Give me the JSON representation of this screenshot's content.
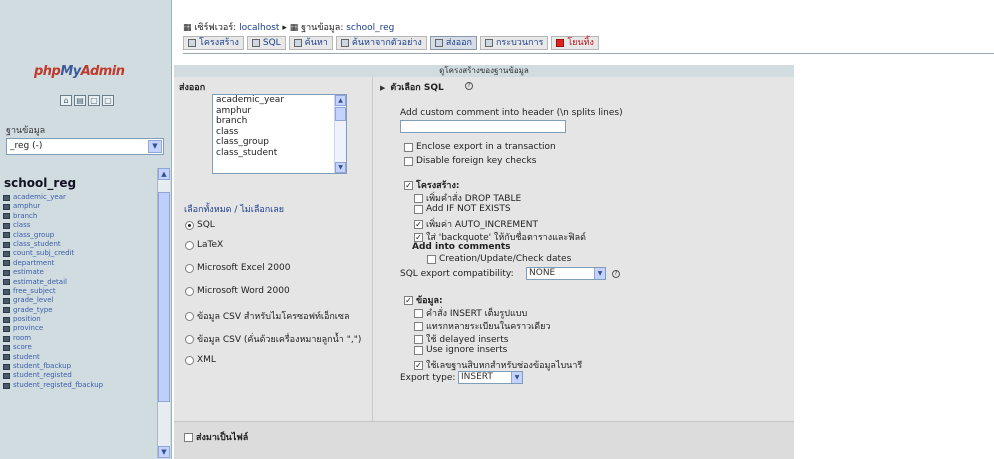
{
  "left": {
    "logo": {
      "part1": "php",
      "part2": "My",
      "part3": "Admin"
    },
    "db_label": "ฐานข้อมูล",
    "db_select": "_reg (-)",
    "db_title": "school_reg",
    "tables": [
      "academic_year",
      "amphur",
      "branch",
      "class",
      "class_group",
      "class_student",
      "count_subj_credit",
      "department",
      "estimate",
      "estimate_detail",
      "free_subject",
      "grade_level",
      "grade_type",
      "position",
      "province",
      "room",
      "score",
      "student",
      "student_fbackup",
      "student_registed",
      "student_registed_fbackup"
    ]
  },
  "breadcrumb": {
    "server_label": "เซิร์ฟเวอร์:",
    "server": "localhost",
    "db_label": "ฐานข้อมูล:",
    "db": "school_reg"
  },
  "tabs": [
    "โครงสร้าง",
    "SQL",
    "ค้นหา",
    "ค้นหาจากตัวอย่าง",
    "ส่งออก",
    "กระบวนการ",
    "โยนทิ้ง"
  ],
  "panel_title": "ดูโครงสร้างของฐานข้อมูล",
  "export": {
    "heading": "ส่งออก",
    "tables": [
      "academic_year",
      "amphur",
      "branch",
      "class",
      "class_group",
      "class_student"
    ],
    "select_all": "เลือกทั้งหมด",
    "separator": "/",
    "select_none": "ไม่เลือกเลย",
    "formats": [
      "SQL",
      "LaTeX",
      "Microsoft Excel 2000",
      "Microsoft Word 2000",
      "ข้อมูล CSV สำหรับไมโครซอฟท์เอ็กเซล",
      "ข้อมูล CSV (คั่นด้วยเครื่องหมายลูกน้ำ \",\")",
      "XML"
    ]
  },
  "options": {
    "heading": "ตัวเลือก SQL",
    "comment_label": "Add custom comment into header (\\n splits lines)",
    "enclose": "Enclose export in a transaction",
    "disable_fk": "Disable foreign key checks",
    "structure": "โครงสร้าง:",
    "drop_table": "เพิ่มคำสั่ง DROP TABLE",
    "if_not_exists": "Add IF NOT EXISTS",
    "auto_increment": "เพิ่มค่า AUTO_INCREMENT",
    "backquote": "ใส่ 'backquote' ให้กับชื่อตารางและฟิลด์",
    "add_comments": "Add into comments",
    "dates": "Creation/Update/Check dates",
    "compat_label": "SQL export compatibility:",
    "compat_value": "NONE",
    "data": "ข้อมูล:",
    "complete_insert": "คำสั่ง INSERT เต็มรูปแบบ",
    "extended_insert": "แทรกหลายระเบียนในคราวเดียว",
    "delayed": "ใช้ delayed inserts",
    "ignore": "Use ignore inserts",
    "hex": "ใช้เลขฐานสิบหกสำหรับช่องข้อมูลไบนารี",
    "type_label": "Export type:",
    "type_value": "INSERT"
  },
  "save_file": "ส่งมาเป็นไฟล์"
}
